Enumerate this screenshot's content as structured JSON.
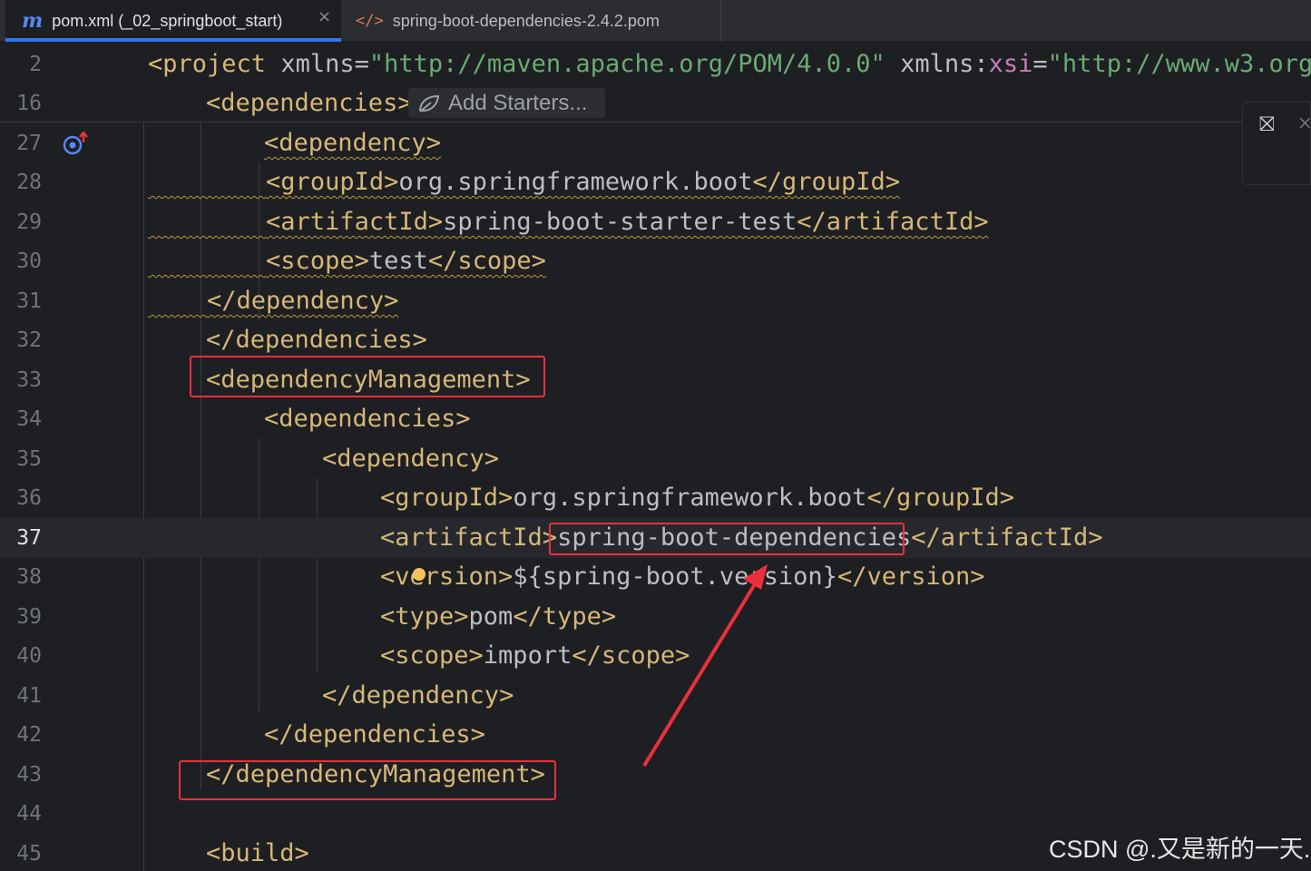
{
  "tabs": [
    {
      "label": "pom.xml (_02_springboot_start)",
      "icon": "m-icon",
      "active": true
    },
    {
      "label": "spring-boot-dependencies-2.4.2.pom",
      "icon": "xml-icon",
      "active": false
    }
  ],
  "tab_close_glyph": "×",
  "hint": {
    "label": "Add Starters..."
  },
  "widget": {
    "reader_glyph": "⛝",
    "close_glyph": "×"
  },
  "lines": {
    "l2": {
      "n": "2"
    },
    "l16": {
      "n": "16",
      "open": "<dependencies>"
    },
    "l27": {
      "n": "27",
      "text": "<dependency>"
    },
    "l28": {
      "n": "28",
      "open": "<groupId>",
      "value": "org.springframework.boot",
      "close": "</groupId>"
    },
    "l29": {
      "n": "29",
      "open": "<artifactId>",
      "value": "spring-boot-starter-test",
      "close": "</artifactId>"
    },
    "l30": {
      "n": "30",
      "open": "<scope>",
      "value": "test",
      "close": "</scope>"
    },
    "l31": {
      "n": "31",
      "text": "</dependency>"
    },
    "l32": {
      "n": "32",
      "text": "</dependencies>"
    },
    "l33": {
      "n": "33",
      "text": "<dependencyManagement>"
    },
    "l34": {
      "n": "34",
      "text": "<dependencies>"
    },
    "l35": {
      "n": "35",
      "text": "<dependency>"
    },
    "l36": {
      "n": "36",
      "open": "<groupId>",
      "value": "org.springframework.boot",
      "close": "</groupId>"
    },
    "l37": {
      "n": "37",
      "open": "<artifactId>",
      "value": "spring-boot-dependencies",
      "close": "</artifactId>"
    },
    "l38": {
      "n": "38",
      "open": "<version>",
      "value": "${spring-boot.version}",
      "close": "</version>"
    },
    "l39": {
      "n": "39",
      "open": "<type>",
      "value": "pom",
      "close": "</type>"
    },
    "l40": {
      "n": "40",
      "open": "<scope>",
      "value": "import",
      "close": "</scope>"
    },
    "l41": {
      "n": "41",
      "text": "</dependency>"
    },
    "l42": {
      "n": "42",
      "text": "</dependencies>"
    },
    "l43": {
      "n": "43",
      "text": "</dependencyManagement>"
    },
    "l44": {
      "n": "44"
    },
    "l45": {
      "n": "45",
      "text": "<build>"
    }
  },
  "project_line": {
    "tag": "<project",
    "attr1": "xmlns",
    "eq1": "=",
    "val1": "\"http://maven.apache.org/POM/4.0.0\"",
    "attr2": "xmlns",
    "colon": ":",
    "ns2": "xsi",
    "eq2": "=",
    "val2": "\"http://www.w3.org"
  },
  "watermark": "CSDN @.又是新的一天.",
  "colors": {
    "tag": "#d5b778",
    "text": "#bcbec4",
    "string": "#6aab73",
    "namespace": "#c77dbb",
    "highlight": "#e8313c",
    "arrow": "#e8313c"
  }
}
